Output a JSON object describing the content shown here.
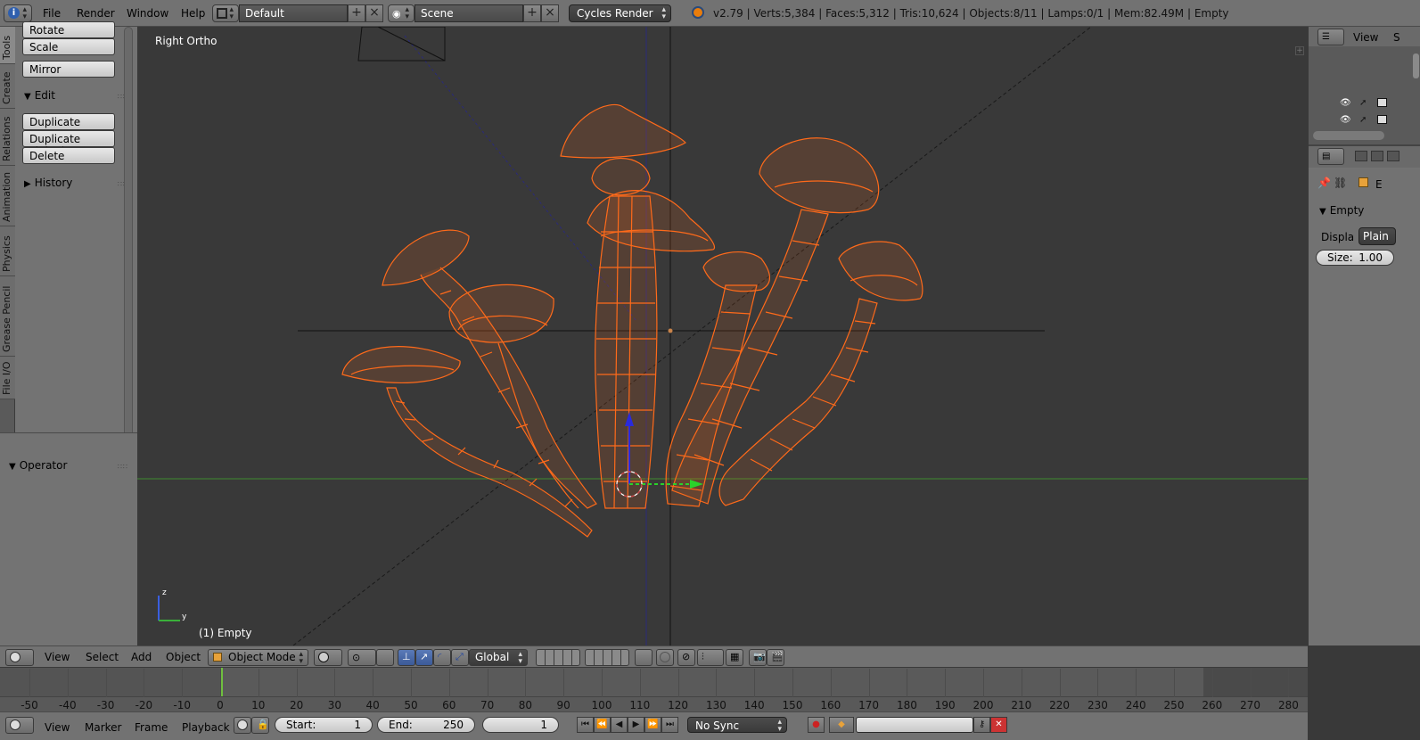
{
  "top_header": {
    "menus": [
      "File",
      "Render",
      "Window",
      "Help"
    ],
    "layout": "Default",
    "scene": "Scene",
    "engine": "Cycles Render",
    "status": "v2.79 | Verts:5,384 | Faces:5,312 | Tris:10,624 | Objects:8/11 | Lamps:0/1 | Mem:82.49M | Empty"
  },
  "left_tabs": [
    "Tools",
    "Create",
    "Relations",
    "Animation",
    "Physics",
    "Grease Pencil",
    "File I/O"
  ],
  "tool_shelf": {
    "transform_buttons": [
      "Rotate",
      "Scale"
    ],
    "mirror": "Mirror",
    "edit_panel": "Edit",
    "edit_buttons": [
      "Duplicate",
      "Duplicate Linked",
      "Delete"
    ],
    "history_panel": "History",
    "operator_panel": "Operator"
  },
  "viewport": {
    "view_name": "Right Ortho",
    "object_label": "(1) Empty",
    "axis_z": "z",
    "axis_y": "y",
    "wire_color": "#ff6a1a"
  },
  "right_panel": {
    "outliner_view": "View",
    "outliner_search": "S",
    "properties_short": "E",
    "panel_title": "Empty",
    "display_label": "Displa",
    "display_value": "Plain",
    "size_label": "Size:",
    "size_value": "1.00"
  },
  "view3d_header": {
    "menus": [
      "View",
      "Select",
      "Add",
      "Object"
    ],
    "mode": "Object Mode",
    "orientation": "Global"
  },
  "timeline": {
    "ticks": [
      "-50",
      "-40",
      "-30",
      "-20",
      "-10",
      "0",
      "10",
      "20",
      "30",
      "40",
      "50",
      "60",
      "70",
      "80",
      "90",
      "100",
      "110",
      "120",
      "130",
      "140",
      "150",
      "160",
      "170",
      "180",
      "190",
      "200",
      "210",
      "220",
      "230",
      "240",
      "250",
      "260",
      "270",
      "280"
    ],
    "menus": [
      "View",
      "Marker",
      "Frame",
      "Playback"
    ],
    "start_label": "Start:",
    "start_value": "1",
    "end_label": "End:",
    "end_value": "250",
    "current_frame": "1",
    "sync": "No Sync"
  }
}
